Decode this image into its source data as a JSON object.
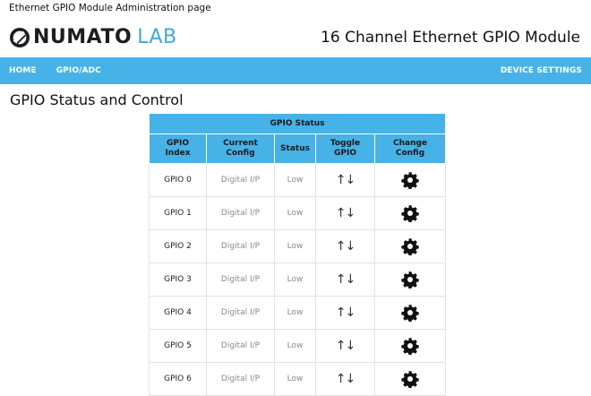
{
  "window": {
    "title": "Ethernet GPIO Module Administration page"
  },
  "header": {
    "logo_text": "NUMATO",
    "logo_accent": "LAB",
    "product_title": "16 Channel Ethernet GPIO Module"
  },
  "nav": {
    "home": "HOME",
    "gpio_adc": "GPIO/ADC",
    "device_settings": "DEVICE SETTINGS"
  },
  "colors": {
    "accent": "#46b2e8",
    "logo_accent": "#3fa9dc"
  },
  "main": {
    "title": "GPIO Status and Control",
    "table": {
      "caption": "GPIO Status",
      "headers": {
        "index_line1": "GPIO",
        "index_line2": "Index",
        "config_line1": "Current",
        "config_line2": "Config",
        "status": "Status",
        "toggle_line1": "Toggle",
        "toggle_line2": "GPIO",
        "change_line1": "Change",
        "change_line2": "Config"
      },
      "toggle_icon": "up-down-arrows-icon",
      "change_icon": "gear-icon",
      "rows": [
        {
          "index": "GPIO 0",
          "config": "Digital I/P",
          "status": "Low",
          "toggle": "↑↓"
        },
        {
          "index": "GPIO 1",
          "config": "Digital I/P",
          "status": "Low",
          "toggle": "↑↓"
        },
        {
          "index": "GPIO 2",
          "config": "Digital I/P",
          "status": "Low",
          "toggle": "↑↓"
        },
        {
          "index": "GPIO 3",
          "config": "Digital I/P",
          "status": "Low",
          "toggle": "↑↓"
        },
        {
          "index": "GPIO 4",
          "config": "Digital I/P",
          "status": "Low",
          "toggle": "↑↓"
        },
        {
          "index": "GPIO 5",
          "config": "Digital I/P",
          "status": "Low",
          "toggle": "↑↓"
        },
        {
          "index": "GPIO 6",
          "config": "Digital I/P",
          "status": "Low",
          "toggle": "↑↓"
        }
      ]
    }
  }
}
